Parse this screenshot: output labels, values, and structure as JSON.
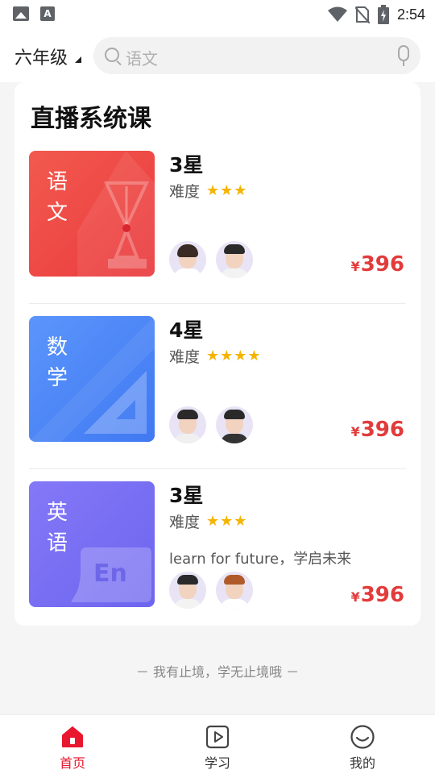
{
  "status_bar": {
    "time": "2:54",
    "icons": [
      "image-icon",
      "a-icon",
      "wifi-icon",
      "no-sim-icon",
      "battery-charging-icon"
    ]
  },
  "header": {
    "grade": "六年级",
    "search_placeholder": "语文"
  },
  "section": {
    "title": "直播系统课",
    "courses": [
      {
        "subject": "语文",
        "level": "3星",
        "difficulty_label": "难度",
        "stars": "★★★",
        "rating": 3,
        "description": "",
        "price_symbol": "¥",
        "price": "396",
        "color": "#ef4747",
        "icon": "pen-nib-icon"
      },
      {
        "subject": "数学",
        "level": "4星",
        "difficulty_label": "难度",
        "stars": "★★★★",
        "rating": 4,
        "description": "",
        "price_symbol": "¥",
        "price": "396",
        "color": "#4a86f7",
        "icon": "set-square-icon"
      },
      {
        "subject": "英语",
        "level": "3星",
        "difficulty_label": "难度",
        "stars": "★★★",
        "rating": 3,
        "description": "learn for future，学启未来",
        "price_symbol": "¥",
        "price": "396",
        "color": "#7b6ff5",
        "icon": "en-bubble-icon"
      }
    ]
  },
  "slogan": "－ 我有止境，学无止境哦 －",
  "bottom_nav": [
    {
      "label": "首页",
      "icon": "home-icon",
      "active": true
    },
    {
      "label": "学习",
      "icon": "play-icon",
      "active": false
    },
    {
      "label": "我的",
      "icon": "smile-icon",
      "active": false
    }
  ],
  "colors": {
    "accent": "#e8172f",
    "price": "#e23b3b",
    "star": "#f5b400"
  }
}
